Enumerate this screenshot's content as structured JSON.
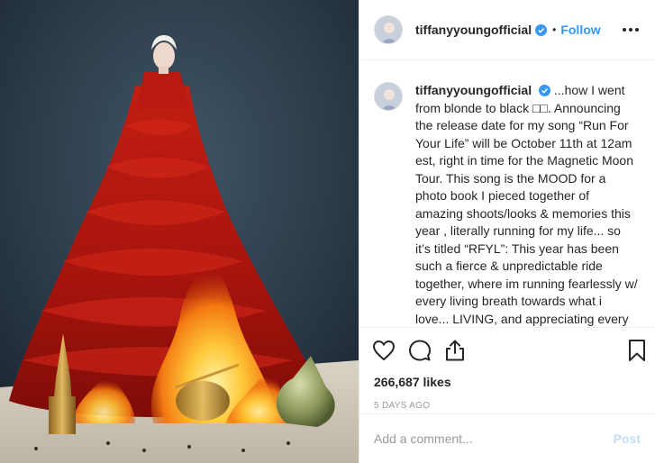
{
  "post": {
    "username": "tiffanyyoungofficial",
    "header_separator": "•",
    "follow_label": "Follow",
    "caption_text": "...how I went from blonde to black □□. Announcing the release date for my song “Run For Your Life” will be October 11th at 12am est, right in time for the Magnetic Moon Tour. This song is the MOOD for a photo book I pieced together of amazing shoots/looks & memories this year , literally running for my life... so it’s titled “RFYL”: This year has been such a fierce & unpredictable ride together, where im running fearlessly w/ every living breath towards what i love... LIVING, and appreciating every moment. you",
    "likes_text": "266,687 likes",
    "timestamp": "5 DAYS AGO",
    "comment_placeholder": "Add a comment...",
    "post_button_label": "Post"
  },
  "icons": {
    "verified": "verified-badge-icon",
    "more": "more-options-icon",
    "like": "heart-icon",
    "comment": "comment-bubble-icon",
    "share": "share-icon",
    "save": "bookmark-icon"
  },
  "colors": {
    "accent": "#3897f0",
    "text": "#262626",
    "muted": "#999999",
    "border": "#efefef"
  }
}
